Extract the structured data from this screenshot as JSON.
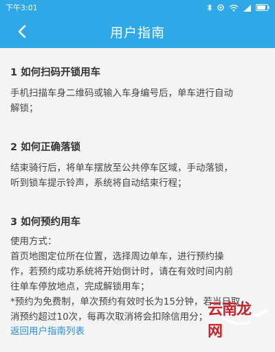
{
  "status_bar": {
    "time": "下午3:01",
    "icons": [
      "bluetooth-icon",
      "rotate-icon",
      "wifi-icon",
      "signal-icon",
      "battery-icon"
    ]
  },
  "nav": {
    "title": "用户指南",
    "back_icon": "chevron-left-icon"
  },
  "sections": [
    {
      "title": "1 如何扫码开锁用车",
      "lines": [
        "手机扫描车身二维码或输入车身编号后，单车进行自动",
        "解锁；"
      ]
    },
    {
      "title": "2 如何正确落锁",
      "lines": [
        "结束骑行后，将单车摆放至公共停车区域，手动落锁，",
        "听到锁车提示铃声，系统将自动结束行程；"
      ]
    },
    {
      "title": "3 如何预约用车",
      "lines": [
        "使用方式：",
        "首页地图定位所在位置，选择周边单车，进行预约操",
        "作，若预约成功系统将开始倒计时，请在有效时间内前",
        "往单车停放地点，完成解锁用车；",
        "*预约为免费制，单次预约有效时长为15分钟，若当日取",
        "消预约超过10次，每再次取消将会扣除信用分；"
      ]
    }
  ],
  "footer": {
    "back_link": "返回用户指南列表"
  },
  "watermark": {
    "text": "云南龙网"
  },
  "colors": {
    "primary": "#2fa8e8",
    "link": "#2a8fd8",
    "background": "#f4f4f4",
    "watermark": "#c8232c"
  }
}
